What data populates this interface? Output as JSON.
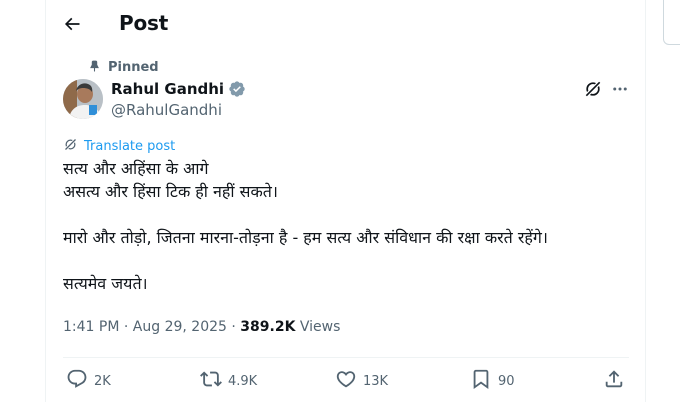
{
  "header": {
    "title": "Post"
  },
  "post": {
    "pinned_label": "Pinned",
    "author": {
      "name": "Rahul Gandhi",
      "handle": "@RahulGandhi",
      "verified": true
    },
    "translate_label": "Translate post",
    "lines": [
      "सत्य और अहिंसा के आगे",
      "असत्य और हिंसा टिक ही नहीं सकते।",
      "",
      "मारो और तोड़ो, जितना मारना-तोड़ना है - हम सत्य और संविधान की रक्षा करते रहेंगे।",
      "",
      "सत्यमेव जयते।"
    ],
    "time": "1:41 PM",
    "separator": "·",
    "date": "Aug 29, 2025",
    "views_count": "389.2K",
    "views_label": "Views"
  },
  "actions": {
    "replies": "2K",
    "reposts": "4.9K",
    "likes": "13K",
    "bookmarks": "90"
  },
  "colors": {
    "accent": "#1d9bf0",
    "muted": "#536471",
    "text": "#0f1419",
    "verified": "#829aab"
  },
  "icons": [
    "back-arrow-icon",
    "pin-icon",
    "verified-badge-icon",
    "grok-icon",
    "more-icon",
    "reply-icon",
    "repost-icon",
    "like-icon",
    "bookmark-icon",
    "share-icon"
  ]
}
